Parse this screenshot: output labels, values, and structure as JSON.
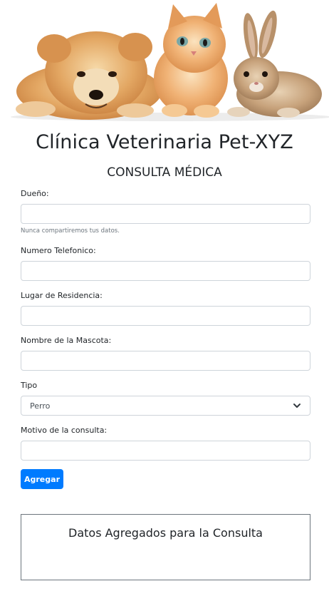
{
  "banner": {
    "alt": "puppy-kitten-bunny-photo"
  },
  "header": {
    "title": "Clínica Veterinaria Pet-XYZ",
    "subtitle": "CONSULTA MÉDICA"
  },
  "form": {
    "owner_label": "Dueño:",
    "owner_value": "",
    "owner_help": "Nunca compartiremos tus datos.",
    "phone_label": "Numero Telefonico:",
    "phone_value": "",
    "residence_label": "Lugar de Residencia:",
    "residence_value": "",
    "pet_name_label": "Nombre de la Mascota:",
    "pet_name_value": "",
    "type_label": "Tipo",
    "type_selected": "Perro",
    "reason_label": "Motivo de la consulta:",
    "reason_value": "",
    "submit_label": "Agregar"
  },
  "results": {
    "title": "Datos Agregados para la Consulta"
  },
  "colors": {
    "primary": "#007bff",
    "border": "#ced4da",
    "muted": "#6c757d"
  }
}
